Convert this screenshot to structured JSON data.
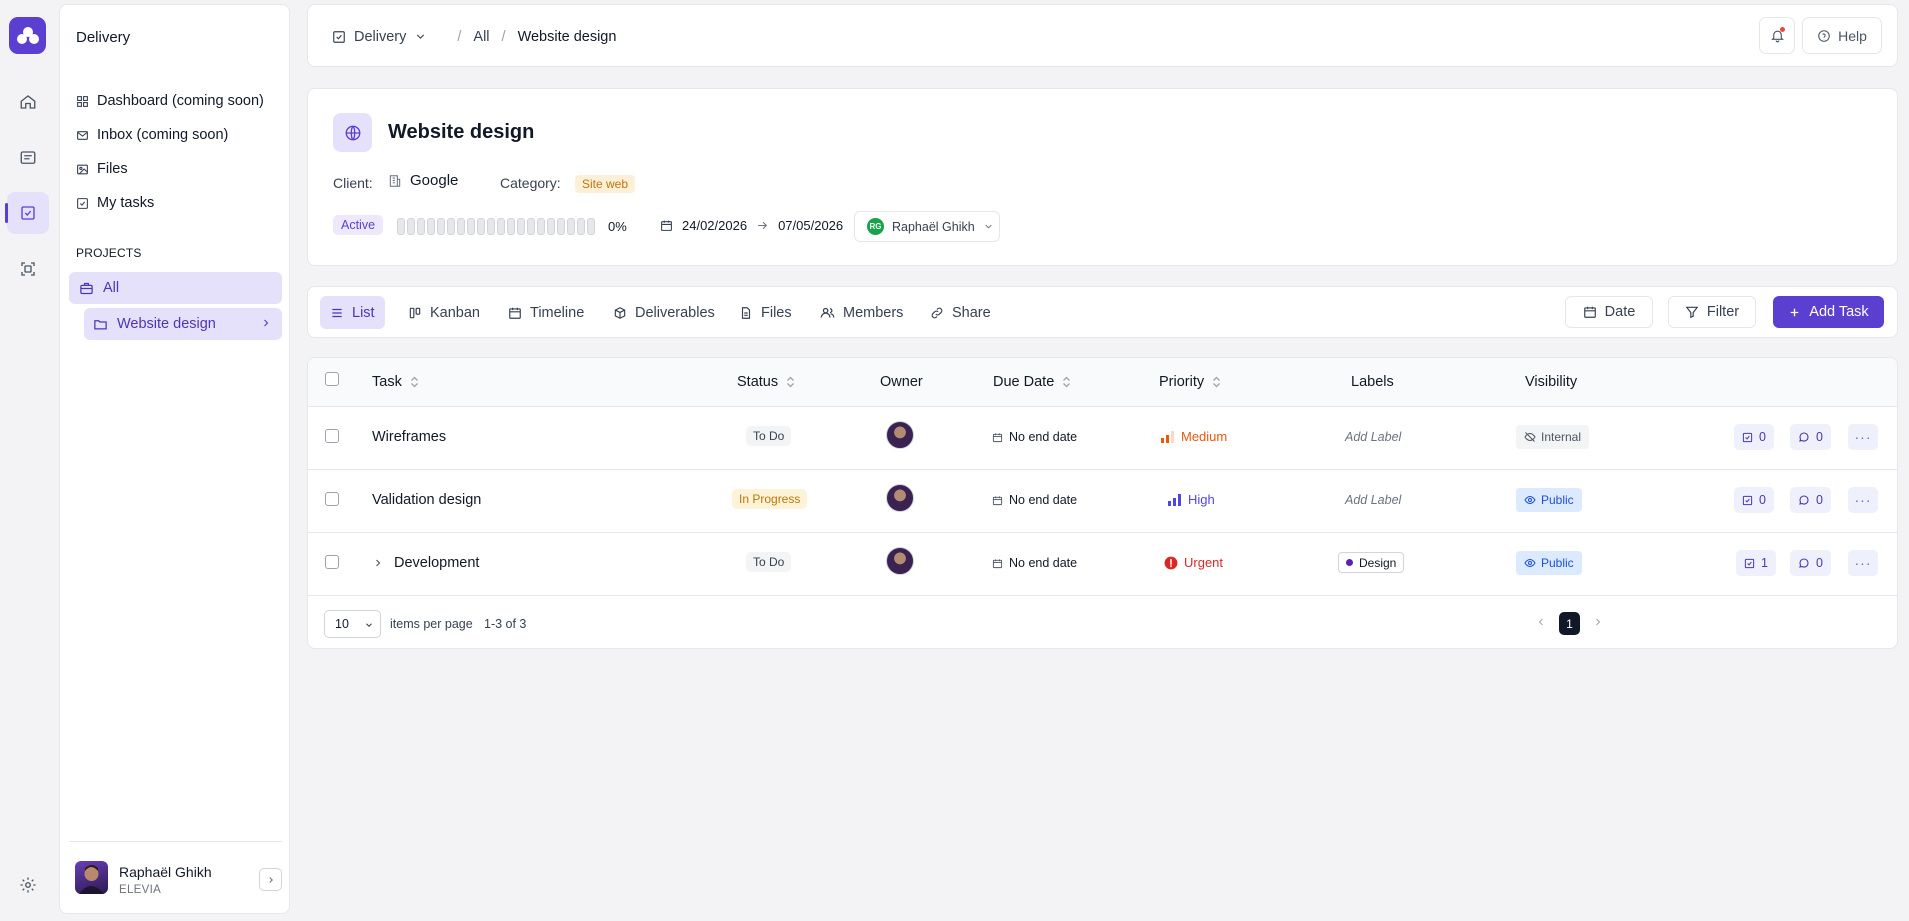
{
  "sidebar": {
    "title": "Delivery",
    "items": [
      {
        "label": "Dashboard (coming soon)",
        "icon": "dashboard-icon"
      },
      {
        "label": "Inbox (coming soon)",
        "icon": "mail-icon"
      },
      {
        "label": "Files",
        "icon": "image-icon"
      },
      {
        "label": "My tasks",
        "icon": "checkbox-icon"
      }
    ],
    "section_label": "PROJECTS",
    "all_label": "All",
    "sub_label": "Website design",
    "user": {
      "name": "Raphaël Ghikh",
      "org": "ELEVIA"
    }
  },
  "topbar": {
    "crumb_root": "Delivery",
    "crumb_sep": "/",
    "crumb_all": "All",
    "crumb_current": "Website design",
    "help_label": "Help"
  },
  "project": {
    "title": "Website design",
    "client_label": "Client:",
    "client_value": "Google",
    "category_label": "Category:",
    "category_value": "Site web",
    "status": "Active",
    "progress_percent": "0%",
    "progress_value": 0,
    "start_date": "24/02/2026",
    "end_date": "07/05/2026",
    "owner_initials": "RG",
    "owner_name": "Raphaël Ghikh"
  },
  "views": {
    "tabs": [
      {
        "label": "List",
        "icon": "list-icon"
      },
      {
        "label": "Kanban",
        "icon": "kanban-icon"
      },
      {
        "label": "Timeline",
        "icon": "calendar-icon"
      },
      {
        "label": "Deliverables",
        "icon": "box-icon"
      },
      {
        "label": "Files",
        "icon": "file-icon"
      },
      {
        "label": "Members",
        "icon": "users-icon"
      },
      {
        "label": "Share",
        "icon": "link-icon"
      }
    ],
    "date_label": "Date",
    "filter_label": "Filter",
    "add_task_label": "Add Task"
  },
  "table": {
    "columns": [
      "Task",
      "Status",
      "Owner",
      "Due Date",
      "Priority",
      "Labels",
      "Visibility"
    ],
    "rows": [
      {
        "task": "Wireframes",
        "status": "To Do",
        "due": "No end date",
        "priority": "Medium",
        "label": "Add Label",
        "visibility": "Internal",
        "tasks": "0",
        "comments": "0"
      },
      {
        "task": "Validation design",
        "status": "In Progress",
        "due": "No end date",
        "priority": "High",
        "label": "Add Label",
        "visibility": "Public",
        "tasks": "0",
        "comments": "0"
      },
      {
        "task": "Development",
        "status": "To Do",
        "due": "No end date",
        "priority": "Urgent",
        "label": "Design",
        "visibility": "Public",
        "tasks": "1",
        "comments": "0"
      }
    ],
    "footer": {
      "per_page": "10",
      "per_page_label": "items per page",
      "range": "1-3 of 3",
      "current_page": "1"
    }
  },
  "colors": {
    "accent": "#5b3fd1",
    "accent_light": "#e6e1fb",
    "medium": "#ea580c",
    "high": "#4f46e5",
    "urgent": "#dc2626"
  }
}
